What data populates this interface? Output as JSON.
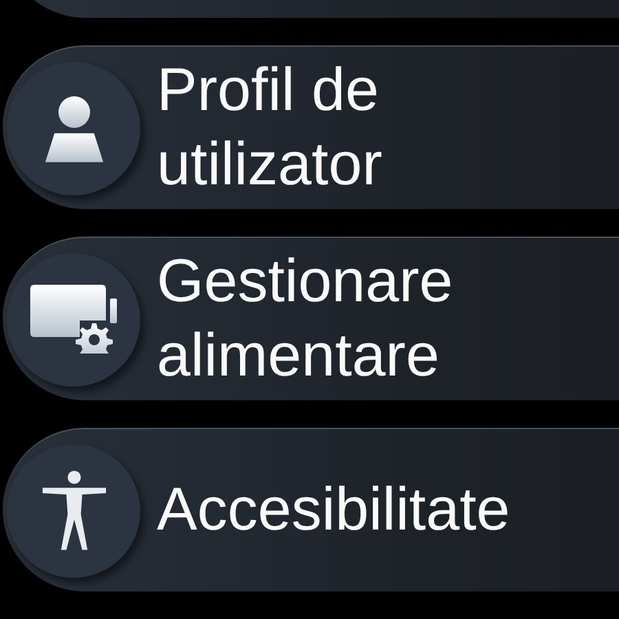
{
  "menu_items": [
    {
      "label": "Profil de utilizator",
      "kind": "user"
    },
    {
      "label": "Gestionare alimentare",
      "kind": "power"
    },
    {
      "label": "Accesibilitate",
      "kind": "accessibility"
    }
  ]
}
